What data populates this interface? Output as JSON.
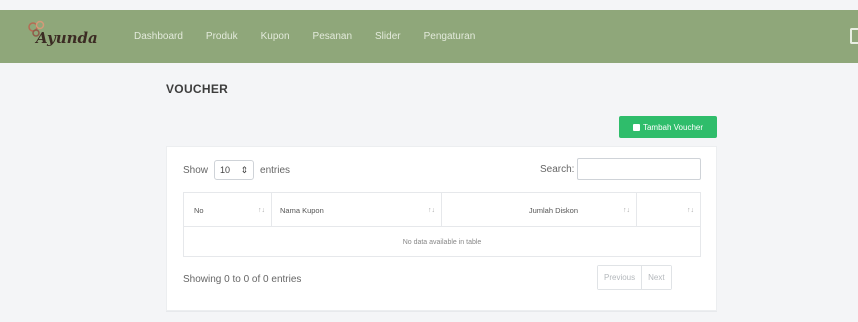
{
  "header": {
    "logo_text": "Ayunda",
    "nav": [
      "Dashboard",
      "Produk",
      "Kupon",
      "Pesanan",
      "Slider",
      "Pengaturan"
    ]
  },
  "page": {
    "title": "VOUCHER",
    "add_button_label": "Tambah Voucher"
  },
  "table_controls": {
    "show_label": "Show",
    "entries_value": "10",
    "entries_label": "entries",
    "search_label": "Search:",
    "search_placeholder": ""
  },
  "table": {
    "columns": [
      "No",
      "Nama Kupon",
      "Jumlah Diskon",
      ""
    ],
    "empty_message": "No data available in table"
  },
  "footer": {
    "info": "Showing 0 to 0 of 0 entries",
    "previous": "Previous",
    "next": "Next"
  },
  "colors": {
    "nav_bg": "#8fa77a",
    "button_green": "#2fbd6b"
  }
}
